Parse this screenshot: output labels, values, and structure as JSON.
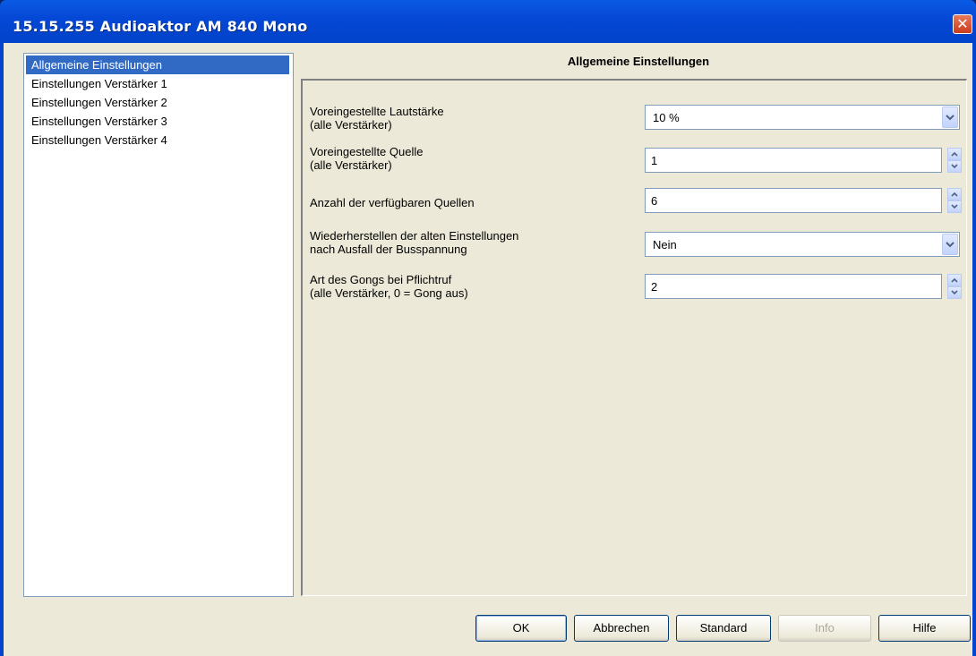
{
  "window": {
    "title": "15.15.255 Audioaktor AM 840 Mono",
    "close_symbol": "✕"
  },
  "sidebar": {
    "items": [
      {
        "label": "Allgemeine Einstellungen",
        "selected": true
      },
      {
        "label": "Einstellungen Verstärker 1",
        "selected": false
      },
      {
        "label": "Einstellungen Verstärker 2",
        "selected": false
      },
      {
        "label": "Einstellungen Verstärker 3",
        "selected": false
      },
      {
        "label": "Einstellungen Verstärker 4",
        "selected": false
      }
    ]
  },
  "main": {
    "section_title": "Allgemeine Einstellungen",
    "params": [
      {
        "label": "Voreingestellte Lautstärke\n(alle Verstärker)",
        "type": "dropdown",
        "value": "10 %"
      },
      {
        "label": "Voreingestellte Quelle\n(alle Verstärker)",
        "type": "spinner",
        "value": "1"
      },
      {
        "label": "Anzahl der verfügbaren Quellen",
        "type": "spinner",
        "value": "6"
      },
      {
        "label": "Wiederherstellen der alten Einstellungen\nnach Ausfall der Busspannung",
        "type": "dropdown",
        "value": "Nein"
      },
      {
        "label": "Art des Gongs bei Pflichtruf\n(alle Verstärker, 0 = Gong aus)",
        "type": "spinner",
        "value": "2"
      }
    ]
  },
  "buttons": {
    "ok": "OK",
    "cancel": "Abbrechen",
    "standard": "Standard",
    "info": "Info",
    "help": "Hilfe"
  },
  "colors": {
    "title_bar": "#0244cc",
    "selection": "#316ac5",
    "dialog_bg": "#ece9d8"
  }
}
